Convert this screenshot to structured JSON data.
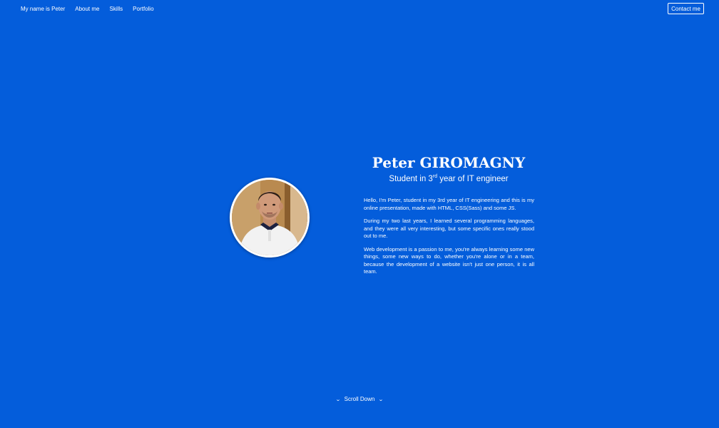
{
  "navbar": {
    "links": [
      {
        "label": "My name is Peter"
      },
      {
        "label": "About me"
      },
      {
        "label": "Skills"
      },
      {
        "label": "Portfolio"
      }
    ],
    "contact_label": "Contact me"
  },
  "hero": {
    "name": "Peter GIROMAGNY",
    "subtitle_prefix": "Student in 3",
    "subtitle_sup": "rd",
    "subtitle_suffix": " year of IT engineer",
    "photo_icon": "profile-photo",
    "paragraphs": [
      "Hello, I'm Peter, student in my 3rd year of IT engineering and this is my online presentation, made with HTML, CSS(Sass) and some JS.",
      "During my two last years, I learned several programming languages, and they were all very interesting, but some specific ones really stood out to me.",
      "Web development is a passion to me, you're always learning some new things, some new ways to do, whether you're alone or in a team, because the development of a website isn't just one person, it is all team."
    ]
  },
  "scroll": {
    "label": "Scroll Down",
    "icon": "chevron-down-icon"
  },
  "colors": {
    "background": "#045ddb",
    "text": "#ffffff"
  }
}
